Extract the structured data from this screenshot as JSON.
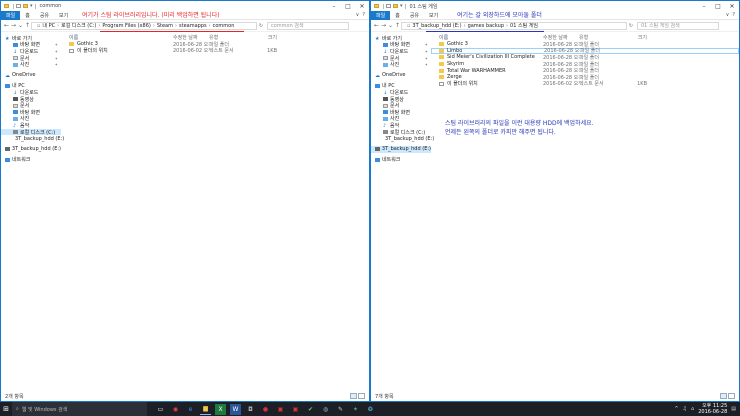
{
  "colors": {
    "accent": "#1979ca",
    "annotation_red": "#e8262a",
    "annotation_blue": "#2a35b8",
    "folder": "#f3c94a",
    "taskbar": "#1c1f26"
  },
  "left": {
    "title": "common",
    "ribbon": {
      "file": "파일",
      "home": "홈",
      "share": "공유",
      "view": "보기"
    },
    "address": [
      "내 PC",
      "로컬 디스크 (C:)",
      "Program Files (x86)",
      "Steam",
      "steamapps",
      "common"
    ],
    "search_placeholder": "common 검색",
    "annotation": "여기가 스팀 라이브러리입니다. (미리 백업하면 됩니다)",
    "columns": {
      "name": "이름",
      "date": "수정한 날짜",
      "type": "유형",
      "size": "크기"
    },
    "rows": [
      {
        "name": "Gothic 3",
        "icon": "folder-icon",
        "date": "2016-06-28 오후...",
        "type": "파일 폴더",
        "size": ""
      },
      {
        "name": "이 폴더의 위치",
        "icon": "text-file-icon",
        "date": "2016-06-02 오전...",
        "type": "텍스트 문서",
        "size": "1KB"
      }
    ],
    "status": "2개 항목"
  },
  "right": {
    "title": "01 스팀 게임",
    "ribbon": {
      "file": "파일",
      "home": "홈",
      "share": "공유",
      "view": "보기"
    },
    "address": [
      "3T_backup_hdd (E:)",
      "games backup",
      "01 스팀 게임"
    ],
    "search_placeholder": "01 스팀 게임 검색",
    "annotation_top": "여기는 갈 외장하드에 모아둘 폴더",
    "annotation_body": [
      "스팀 라이브러리의 파일을 이런 대용량 HDD에 백업하세요.",
      "언제든 왼쪽의 폴더로 카피만 해주면 됩니다."
    ],
    "columns": {
      "name": "이름",
      "date": "수정한 날짜",
      "type": "유형",
      "size": "크기"
    },
    "rows": [
      {
        "name": "Gothic 3",
        "icon": "folder-icon",
        "date": "2016-06-28 오후...",
        "type": "파일 폴더",
        "size": ""
      },
      {
        "name": "Limbo",
        "icon": "folder-icon",
        "date": "2016-06-28 오후...",
        "type": "파일 폴더",
        "size": ""
      },
      {
        "name": "Sid Meier's Civilization III Complete",
        "icon": "folder-icon",
        "date": "2016-06-28 오후...",
        "type": "파일 폴더",
        "size": ""
      },
      {
        "name": "Skyrim",
        "icon": "folder-icon",
        "date": "2016-06-28 오후...",
        "type": "파일 폴더",
        "size": ""
      },
      {
        "name": "Total War WARHAMMER",
        "icon": "folder-icon",
        "date": "2016-06-28 오후...",
        "type": "파일 폴더",
        "size": ""
      },
      {
        "name": "Zerge",
        "icon": "folder-icon",
        "date": "2016-06-28 오후...",
        "type": "파일 폴더",
        "size": ""
      },
      {
        "name": "이 폴더의 위치",
        "icon": "text-file-icon",
        "date": "2016-06-02 오전...",
        "type": "텍스트 문서",
        "size": "1KB"
      }
    ],
    "status": "7개 항목"
  },
  "nav": {
    "quick_access": "바로 가기",
    "quick_items": [
      "바탕 화면",
      "다운로드",
      "문서",
      "사진"
    ],
    "onedrive": "OneDrive",
    "this_pc": "내 PC",
    "pc_items": [
      "다운로드",
      "동영상",
      "문서",
      "바탕 화면",
      "사진",
      "음악",
      "로컬 디스크 (C:)",
      "3T_backup_hdd (E:)"
    ],
    "drive_item": "3T_backup_hdd (E:)",
    "network": "네트워크"
  },
  "taskbar": {
    "search_placeholder": "웹 및 Windows 검색",
    "time": "오후 11:25",
    "date": "2016-06-28"
  }
}
